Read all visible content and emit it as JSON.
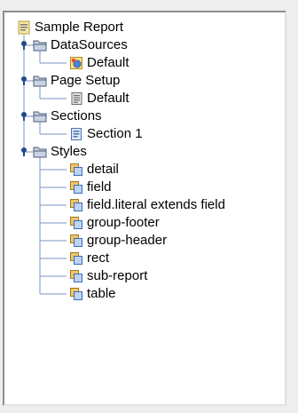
{
  "tree": {
    "root": {
      "label": "Sample Report",
      "icon": "report-icon"
    },
    "groups": [
      {
        "label": "DataSources",
        "icon": "folder-icon",
        "expanded": true,
        "children": [
          {
            "label": "Default",
            "icon": "datasource-icon"
          }
        ]
      },
      {
        "label": "Page Setup",
        "icon": "folder-icon",
        "expanded": true,
        "children": [
          {
            "label": "Default",
            "icon": "page-icon"
          }
        ]
      },
      {
        "label": "Sections",
        "icon": "folder-icon",
        "expanded": true,
        "children": [
          {
            "label": "Section 1",
            "icon": "section-icon"
          }
        ]
      },
      {
        "label": "Styles",
        "icon": "folder-icon",
        "expanded": true,
        "children": [
          {
            "label": "detail",
            "icon": "style-icon"
          },
          {
            "label": "field",
            "icon": "style-icon"
          },
          {
            "label": "field.literal extends field",
            "icon": "style-icon"
          },
          {
            "label": "group-footer",
            "icon": "style-icon"
          },
          {
            "label": "group-header",
            "icon": "style-icon"
          },
          {
            "label": "rect",
            "icon": "style-icon"
          },
          {
            "label": "sub-report",
            "icon": "style-icon"
          },
          {
            "label": "table",
            "icon": "style-icon"
          }
        ]
      }
    ]
  },
  "colors": {
    "tree_line": "#7a96c0",
    "toggle": "#214a88",
    "folder": "#c9d3e3",
    "style_icon": "#5a86c9"
  }
}
